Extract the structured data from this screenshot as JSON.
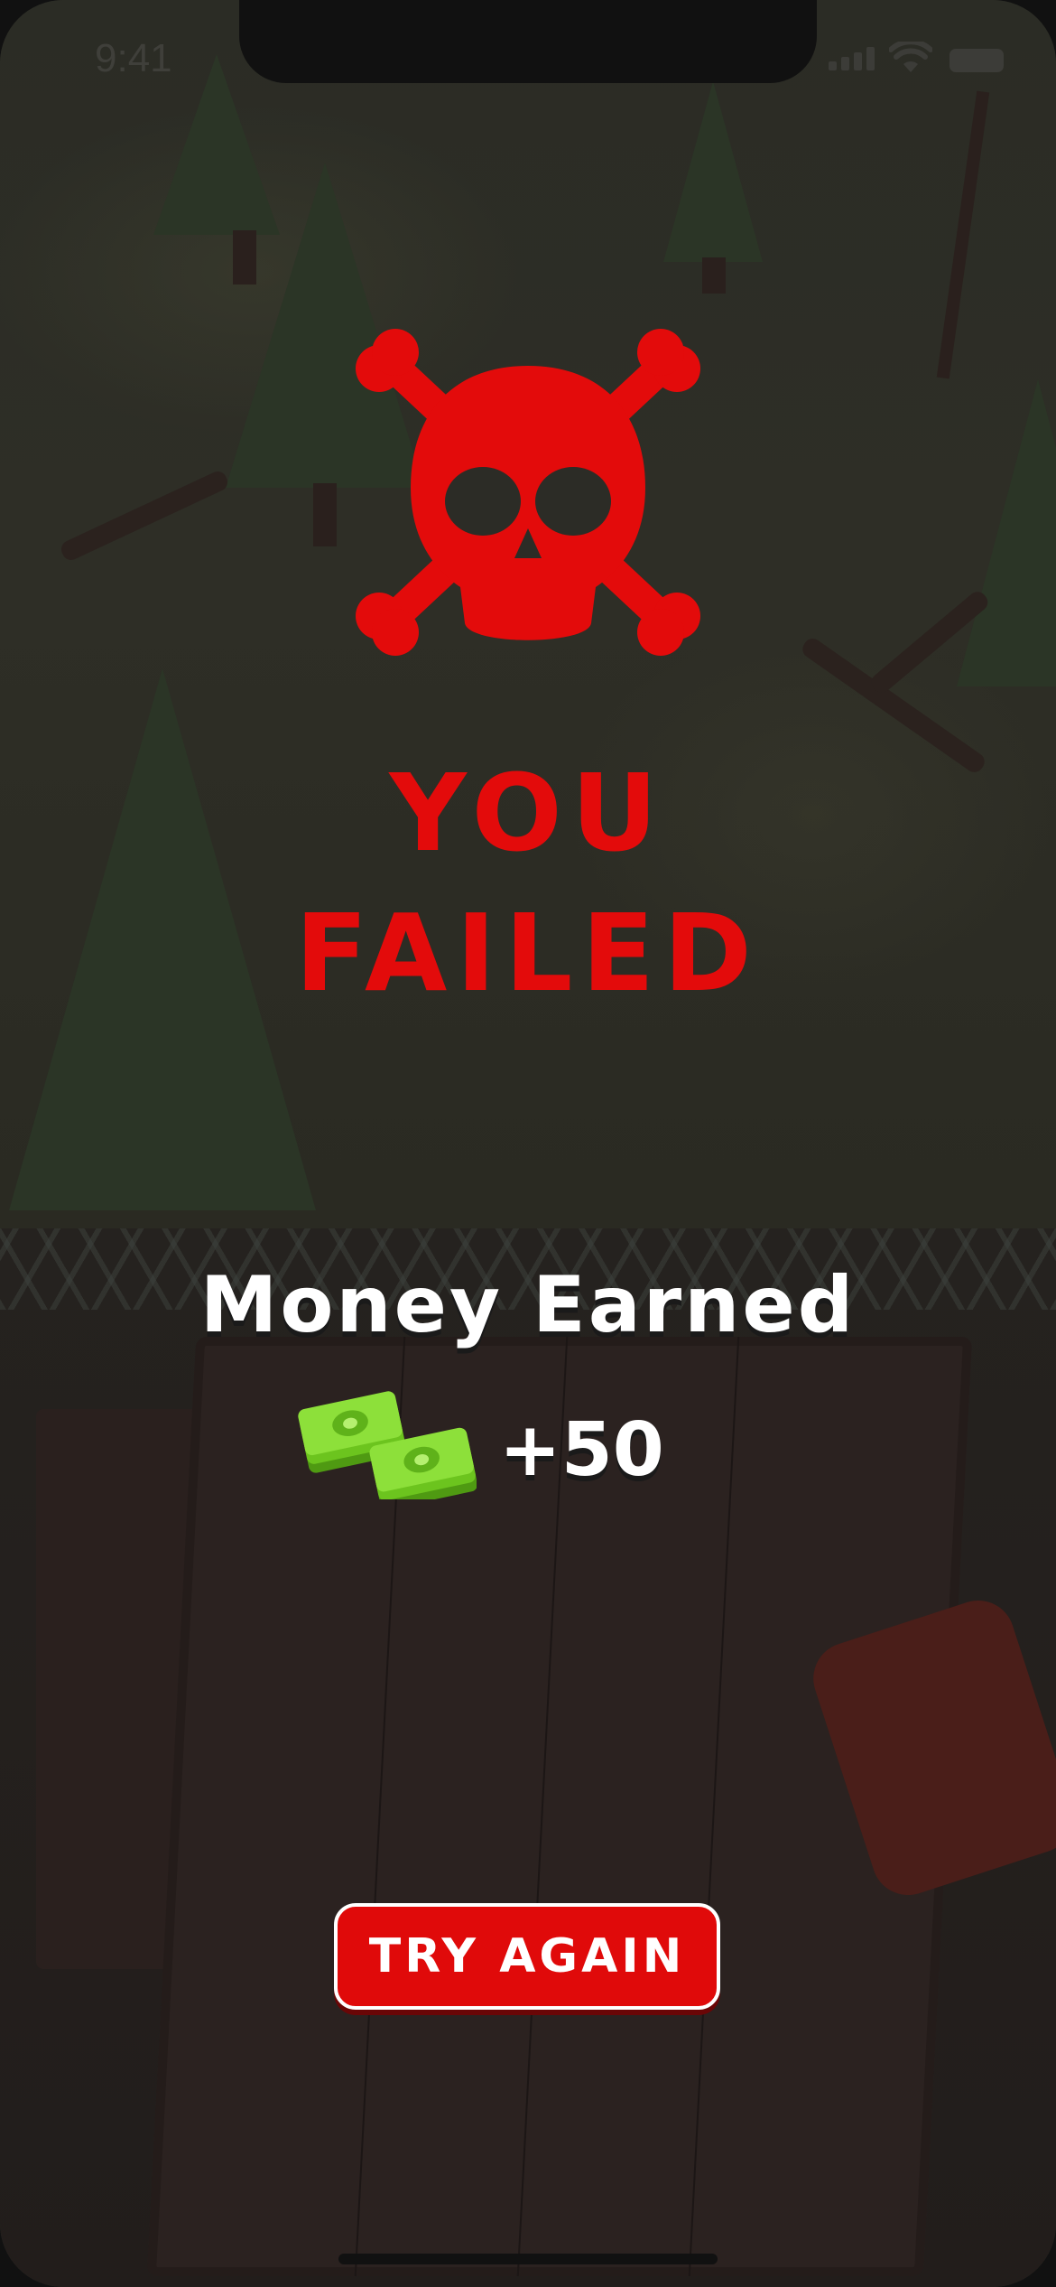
{
  "status_bar": {
    "time": "9:41",
    "icons": [
      "cellular-signal-icon",
      "wifi-icon",
      "battery-icon"
    ]
  },
  "result": {
    "icon": "skull-crossbones-icon",
    "title_line1": "YOU",
    "title_line2": "FAILED",
    "title_color": "#e30b0b"
  },
  "reward": {
    "label": "Money Earned",
    "icon": "cash-stack-icon",
    "amount": "+50"
  },
  "actions": {
    "try_again_label": "TRY AGAIN",
    "button_color": "#e00a0a"
  }
}
